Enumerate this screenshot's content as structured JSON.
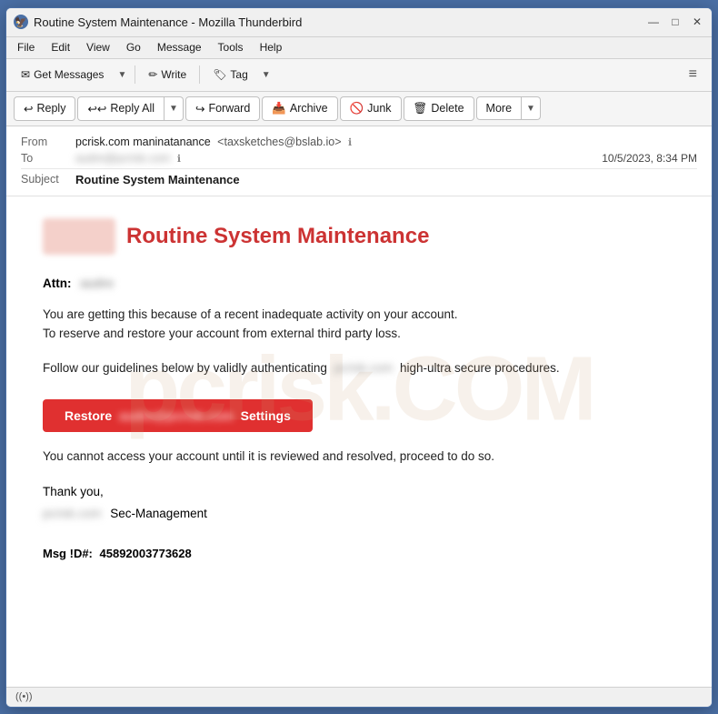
{
  "window": {
    "title": "Routine System Maintenance - Mozilla Thunderbird",
    "icon": "🦅"
  },
  "window_controls": {
    "minimize": "—",
    "maximize": "□",
    "close": "✕"
  },
  "menu": {
    "items": [
      "File",
      "Edit",
      "View",
      "Go",
      "Message",
      "Tools",
      "Help"
    ]
  },
  "toolbar": {
    "get_messages": "Get Messages",
    "write": "Write",
    "tag": "Tag",
    "hamburger": "≡"
  },
  "action_toolbar": {
    "reply": "Reply",
    "reply_all": "Reply All",
    "forward": "Forward",
    "archive": "Archive",
    "junk": "Junk",
    "delete": "Delete",
    "more": "More"
  },
  "email_header": {
    "from_label": "From",
    "from_name": "pcrisk.com maninatanance",
    "from_email": "<taxsketches@bslab.io>",
    "to_label": "To",
    "to_email": "audre@pcrisk.com",
    "date": "10/5/2023, 8:34 PM",
    "subject_label": "Subject",
    "subject": "Routine System Maintenance"
  },
  "email_body": {
    "logo_text": "pcrisk.com",
    "title": "Routine System Maintenance",
    "attn": "Attn:",
    "attn_name": "audre",
    "paragraph1_line1": "You are getting this because of a recent inadequate activity on your account.",
    "paragraph1_line2": "To reserve and restore your account from external third party loss.",
    "paragraph2_start": "Follow our guidelines below by validly authenticating",
    "paragraph2_blurred": "pcrisk.com",
    "paragraph2_end": "high-ultra secure procedures.",
    "restore_btn_start": "Restore",
    "restore_btn_email": "audre@pcrisk.com",
    "restore_btn_end": "Settings",
    "paragraph3": "You cannot access your account until it is reviewed and resolved, proceed to do so.",
    "thank_you": "Thank you,",
    "company_blurred": "pcrisk.com",
    "company_suffix": "Sec-Management",
    "msg_id_label": "Msg !D#:",
    "msg_id_value": "45892003773628"
  },
  "status_bar": {
    "icon": "((•))",
    "text": ""
  },
  "icons": {
    "reply": "↩",
    "reply_all": "↩↩",
    "forward": "↪",
    "archive": "📥",
    "junk": "🚫",
    "delete": "🗑",
    "envelope": "✉",
    "pencil": "✏",
    "tag": "🏷",
    "shield": "🛡",
    "info": "ℹ"
  }
}
